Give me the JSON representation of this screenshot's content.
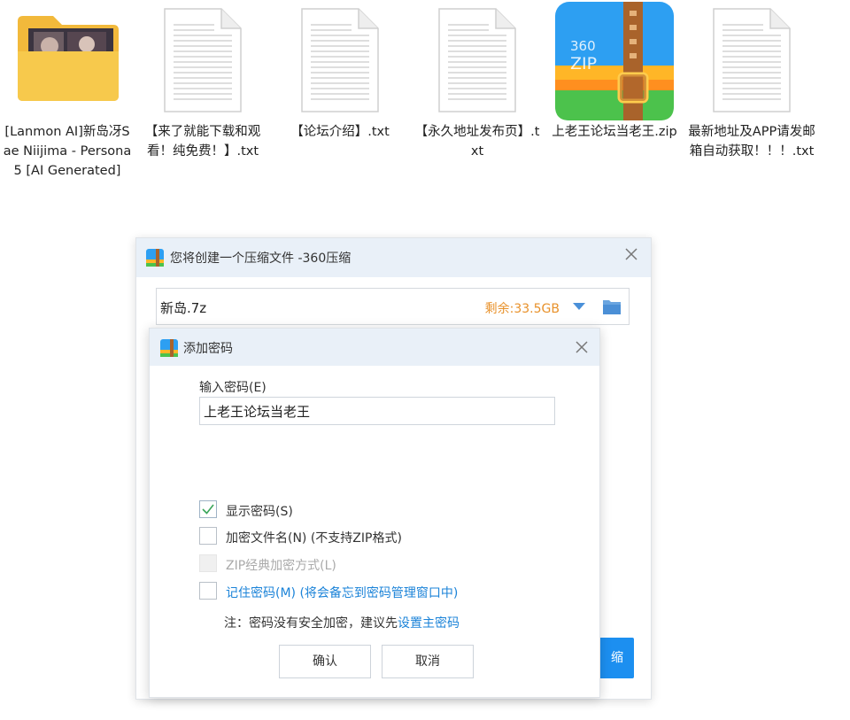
{
  "desktop": {
    "files": [
      {
        "label": "[Lanmon AI]新岛冴Sae Niijima - Persona 5 [AI Generated]",
        "type": "folder"
      },
      {
        "label": "【来了就能下载和观看！纯免费！】.txt",
        "type": "text"
      },
      {
        "label": "【论坛介绍】.txt",
        "type": "text"
      },
      {
        "label": "【永久地址发布页】.txt",
        "type": "text"
      },
      {
        "label": "上老王论坛当老王.zip",
        "type": "zip",
        "icon_text": "360\nZIP"
      },
      {
        "label": "最新地址及APP请发邮箱自动获取！！！.txt",
        "type": "text"
      }
    ]
  },
  "main_dialog": {
    "title": "您将创建一个压缩文件 -360压缩",
    "filename": "新岛.7z",
    "free_space": "剩余:33.5GB",
    "compress_button": "缩",
    "icons": {
      "title": "archive-app-icon",
      "close": "close-icon",
      "dropdown": "chevron-down-icon",
      "folder": "folder-icon"
    }
  },
  "password_dialog": {
    "title": "添加密码",
    "input_label": "输入密码(E)",
    "password_value": "上老王论坛当老王",
    "options": [
      {
        "label": "显示密码(S)",
        "checked": true,
        "disabled": false
      },
      {
        "label": "加密文件名(N) (不支持ZIP格式)",
        "checked": false,
        "disabled": false
      },
      {
        "label": "ZIP经典加密方式(L)",
        "checked": false,
        "disabled": true
      },
      {
        "label": "记住密码(M) (将会备忘到密码管理窗口中)",
        "checked": false,
        "disabled": false
      }
    ],
    "note_prefix": "注：密码没有安全加密，建议先",
    "note_link": "设置主密码",
    "ok_button": "确认",
    "cancel_button": "取消"
  },
  "colors": {
    "accent_blue": "#1c8ff0",
    "link_blue": "#1b83d8",
    "free_space_orange": "#e8912a",
    "title_bar_bg": "#e9f0f8"
  }
}
